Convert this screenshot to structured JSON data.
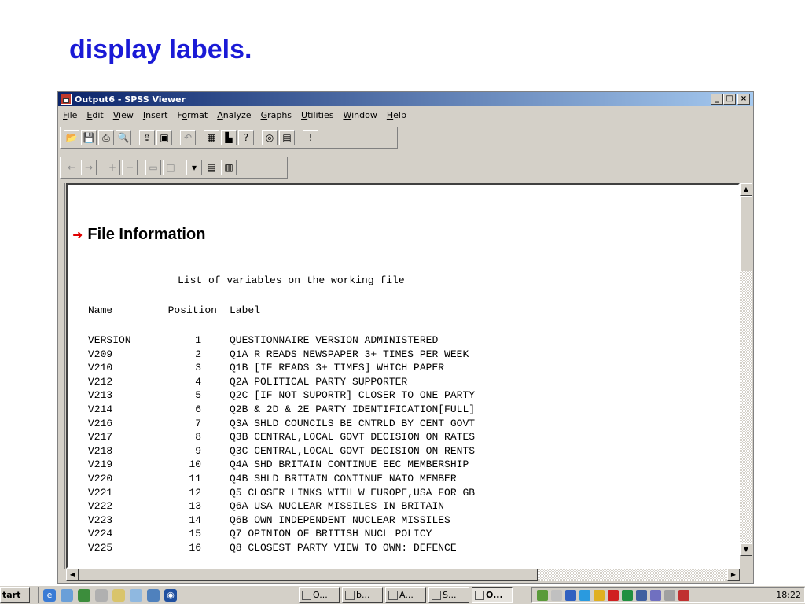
{
  "slide": {
    "title": "display labels."
  },
  "window": {
    "title": "Output6 - SPSS Viewer",
    "buttons": {
      "minimize": "_",
      "maximize": "□",
      "close": "×"
    }
  },
  "menu": [
    {
      "label": "File",
      "ul": "F",
      "rest": "ile"
    },
    {
      "label": "Edit",
      "ul": "E",
      "rest": "dit"
    },
    {
      "label": "View",
      "ul": "V",
      "rest": "iew"
    },
    {
      "label": "Insert",
      "ul": "I",
      "rest": "nsert"
    },
    {
      "label": "Format",
      "ul": "o",
      "pre": "F",
      "rest": "rmat"
    },
    {
      "label": "Analyze",
      "ul": "A",
      "rest": "nalyze"
    },
    {
      "label": "Graphs",
      "ul": "G",
      "rest": "raphs"
    },
    {
      "label": "Utilities",
      "ul": "U",
      "rest": "tilities"
    },
    {
      "label": "Window",
      "ul": "W",
      "rest": "indow"
    },
    {
      "label": "Help",
      "ul": "H",
      "rest": "elp"
    }
  ],
  "toolbar1_icons": [
    "open-icon",
    "save-icon",
    "print-icon",
    "print-preview-icon",
    "export-icon",
    "dialog-recall-icon",
    "undo-icon",
    "goto-data-icon",
    "goto-chart-icon",
    "variables-icon",
    "use-sets-icon",
    "designate-window-icon",
    "run-icon"
  ],
  "toolbar2_icons": [
    "promote-icon",
    "demote-icon",
    "expand-icon",
    "collapse-icon",
    "show-icon",
    "hide-icon",
    "insert-heading-icon",
    "insert-title-icon",
    "insert-text-icon"
  ],
  "output": {
    "heading": "File Information",
    "table_title": "List of variables on the working file",
    "columns": {
      "name": "Name",
      "position": "Position",
      "label": "Label"
    },
    "rows": [
      {
        "name": "VERSION",
        "position": "1",
        "label": "QUESTIONNAIRE VERSION ADMINISTERED"
      },
      {
        "name": "V209",
        "position": "2",
        "label": "Q1A R READS NEWSPAPER 3+ TIMES PER WEEK"
      },
      {
        "name": "V210",
        "position": "3",
        "label": "Q1B [IF READS 3+ TIMES] WHICH PAPER"
      },
      {
        "name": "V212",
        "position": "4",
        "label": "Q2A POLITICAL PARTY SUPPORTER"
      },
      {
        "name": "V213",
        "position": "5",
        "label": "Q2C [IF NOT SUPORTR] CLOSER TO ONE PARTY"
      },
      {
        "name": "V214",
        "position": "6",
        "label": "Q2B & 2D & 2E PARTY IDENTIFICATION[FULL]"
      },
      {
        "name": "V216",
        "position": "7",
        "label": "Q3A SHLD COUNCILS BE CNTRLD BY CENT GOVT"
      },
      {
        "name": "V217",
        "position": "8",
        "label": "Q3B CENTRAL,LOCAL GOVT DECISION ON RATES"
      },
      {
        "name": "V218",
        "position": "9",
        "label": "Q3C CENTRAL,LOCAL GOVT DECISION ON RENTS"
      },
      {
        "name": "V219",
        "position": "10",
        "label": "Q4A SHD BRITAIN CONTINUE EEC MEMBERSHIP"
      },
      {
        "name": "V220",
        "position": "11",
        "label": "Q4B SHLD BRITAIN CONTINUE NATO MEMBER"
      },
      {
        "name": "V221",
        "position": "12",
        "label": "Q5 CLOSER LINKS WITH W EUROPE,USA FOR GB"
      },
      {
        "name": "V222",
        "position": "13",
        "label": "Q6A USA NUCLEAR MISSILES IN BRITAIN"
      },
      {
        "name": "V223",
        "position": "14",
        "label": "Q6B OWN INDEPENDENT NUCLEAR MISSILES"
      },
      {
        "name": "V224",
        "position": "15",
        "label": "Q7 OPINION OF BRITISH NUCL POLICY"
      },
      {
        "name": "V225",
        "position": "16",
        "label": "Q8 CLOSEST PARTY VIEW TO OWN: DEFENCE"
      }
    ]
  },
  "taskbar": {
    "start_label": "tart",
    "tasks": [
      {
        "label": "O...",
        "icon": "ie-icon"
      },
      {
        "label": "b...",
        "icon": "spreadsheet-icon"
      },
      {
        "label": "A...",
        "icon": "word-icon"
      },
      {
        "label": "S...",
        "icon": "spss-icon"
      },
      {
        "label": "O...",
        "icon": "spss-viewer-icon",
        "active": true
      }
    ],
    "clock": "18:22"
  },
  "colors": {
    "title_blue": "#1a1ad6",
    "titlebar": "#0a246a",
    "arrow_red": "#e00000"
  }
}
